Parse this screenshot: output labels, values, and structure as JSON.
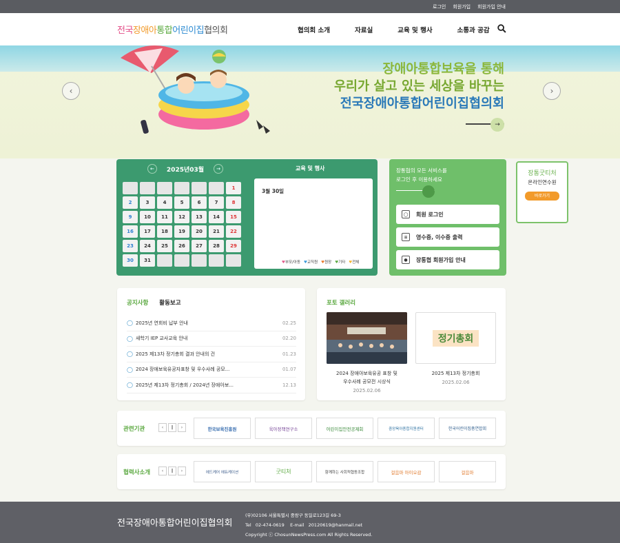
{
  "top_links": [
    "로그인",
    "회원가입",
    "회원가입 안내"
  ],
  "logo": {
    "parts": [
      "전국",
      "장애아",
      "통합",
      "어린이집",
      "협의회"
    ]
  },
  "nav": [
    "협의회 소개",
    "자료실",
    "교육 및 행사",
    "소통과 공감"
  ],
  "hero": {
    "line1": "장애아통합보육을 통해",
    "line2": "우리가 살고 있는 세상을 바꾸는",
    "line3": "전국장애아통합어린이집협의회"
  },
  "calendar": {
    "month": "2025년03월",
    "weeks": [
      [
        "",
        "",
        "",
        "",
        "",
        "",
        "1"
      ],
      [
        "2",
        "3",
        "4",
        "5",
        "6",
        "7",
        "8"
      ],
      [
        "9",
        "10",
        "11",
        "12",
        "13",
        "14",
        "15"
      ],
      [
        "16",
        "17",
        "18",
        "19",
        "20",
        "21",
        "22"
      ],
      [
        "23",
        "24",
        "25",
        "26",
        "27",
        "28",
        "29"
      ],
      [
        "30",
        "31",
        "",
        "",
        "",
        "",
        ""
      ]
    ]
  },
  "events": {
    "title": "교육 및 행사",
    "date": "3월 30일",
    "legend": [
      {
        "label": "부모/아동",
        "color": "#e25a8a"
      },
      {
        "label": "교직원",
        "color": "#3a9ad9"
      },
      {
        "label": "원장",
        "color": "#e97a2c"
      },
      {
        "label": "기타",
        "color": "#5aa83f"
      },
      {
        "label": "전체",
        "color": "#f2b632"
      }
    ]
  },
  "login_box": {
    "desc_line1": "장통협의 모든 서비스를",
    "desc_line2": "로그인 후 이용하세요",
    "buttons": [
      "회원 로그인",
      "영수증, 이수증 출력",
      "장통협 회원가입 안내"
    ]
  },
  "side_banner": {
    "title": "장통굿티처",
    "subtitle": "온라인연수원",
    "go": "바로가기"
  },
  "notice": {
    "tab_active": "공지사항",
    "tab_other": "활동보고",
    "items": [
      {
        "title": "2025년 연회비 납부 안내",
        "date": "02.25"
      },
      {
        "title": "새학기 IEP 교사교육 안내",
        "date": "02.20"
      },
      {
        "title": "2025 제13차 정기총회 결과 안내의 건",
        "date": "01.23"
      },
      {
        "title": "2024 장애보육유공자표창 및 우수사례 공모...",
        "date": "01.07"
      },
      {
        "title": "2025년 제13차 정기총회 / 2024년 장애아보...",
        "date": "12.13"
      }
    ]
  },
  "gallery": {
    "title": "포토 갤러리",
    "items": [
      {
        "caption1": "2024 장애아보육유공 표창 및",
        "caption2": "우수사례 공모전 시상식",
        "date": "2025.02.06"
      },
      {
        "caption1": "2025 제13차 정기총회",
        "caption2": "",
        "date": "2025.02.06",
        "image_text": "정기총회"
      }
    ]
  },
  "related": {
    "label": "관련기관",
    "logos": [
      "한국보육진흥원",
      "육아정책연구소",
      "어린이집안전공제회",
      "중앙육아종합지원센터",
      "한국어린이집총연합회"
    ]
  },
  "partners": {
    "label": "협력사소개",
    "logos": [
      "에드케어 에듀케이션",
      "굿티처",
      "함께하는 사회적협동조합",
      "걸음마 아이오감",
      "걸음마"
    ]
  },
  "footer": {
    "logo": "전국장애아통합어린이집협의회",
    "address": "(우)02106 서울특별시 중랑구 동일로123길 69-3",
    "tel_label": "Tel",
    "tel": "02-474-0619",
    "email_label": "E-mail",
    "email": "20120619@hanmail.net",
    "copyright": "Copyright ⓒ ChosunNewsPress.com All Rights Reserved."
  },
  "colors": {
    "brand_green": "#3c9a6f",
    "login_green": "#6fbf6a",
    "accent_blue": "#2a79b8",
    "footer": "#5f6066"
  }
}
